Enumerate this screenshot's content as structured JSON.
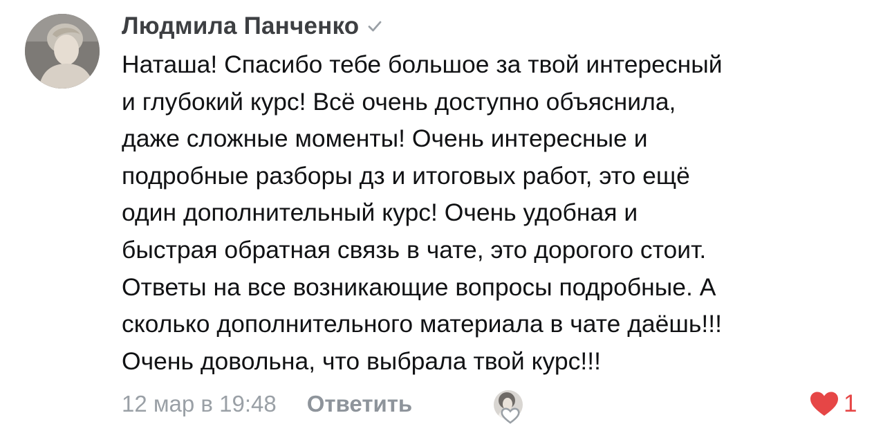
{
  "comment": {
    "author": {
      "name": "Людмила Панченко",
      "avatar_icon": "user-photo",
      "verified_icon": "checkmark-icon"
    },
    "text_lines": [
      "Наташа! Спасибо тебе большое за твой интересный",
      "и глубокий курс! Всё очень доступно объяснила,",
      "даже сложные моменты! Очень интересные и",
      "подробные разборы дз и итоговых работ, это ещё",
      "один дополнительный курс! Очень удобная и",
      "быстрая обратная связь в чате, это дорогого стоит.",
      "Ответы на все возникающие вопросы подробные. А",
      "сколько дополнительного материала в чате даёшь!!!",
      "Очень довольна, что выбрала твой курс!!!"
    ],
    "footer": {
      "timestamp": "12 мар в 19:48",
      "reply_label": "Ответить",
      "liker_icon": "liker-avatar-photo",
      "like_icon": "heart-icon",
      "like_count": "1"
    },
    "colors": {
      "like": "#e64646",
      "muted": "#9aa0a6",
      "author": "#3d3f42",
      "text": "#111214"
    }
  }
}
